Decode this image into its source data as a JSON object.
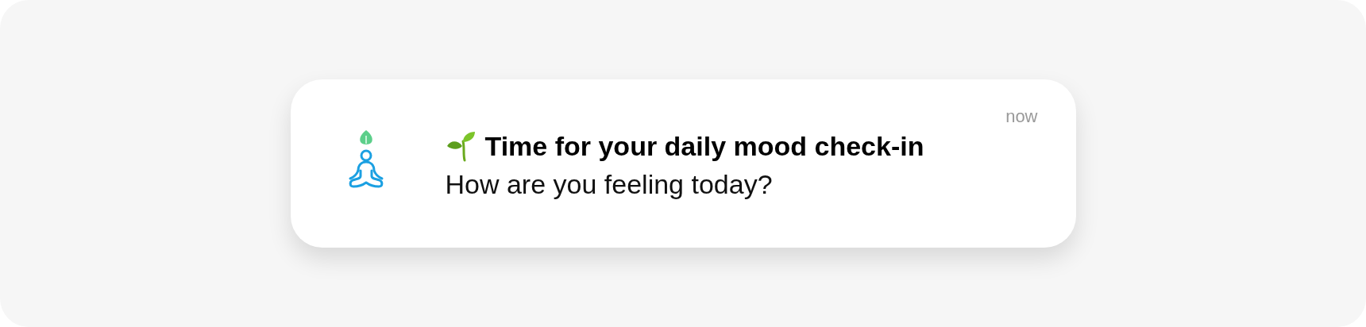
{
  "notification": {
    "time": "now",
    "title": "Time for your daily mood check-in",
    "body": "How are you feeling today?"
  }
}
